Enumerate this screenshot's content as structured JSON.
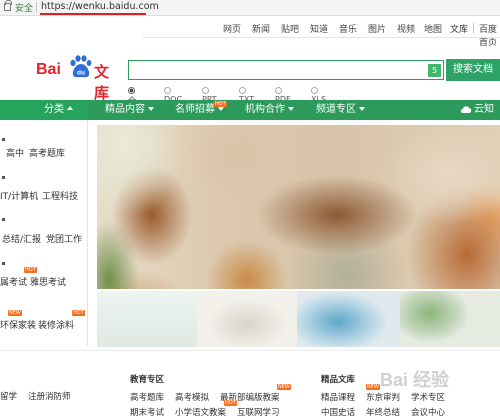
{
  "address_bar": {
    "security_label": "安全",
    "url": "https://wenku.baidu.com"
  },
  "top_nav": {
    "links": [
      "网页",
      "新闻",
      "贴吧",
      "知道",
      "音乐",
      "图片",
      "视频",
      "地图",
      "文库"
    ],
    "right_link": "百度首页"
  },
  "logo": {
    "text_left": "Bai",
    "paw_text": "du",
    "text_right": "文库"
  },
  "search": {
    "placeholder": "",
    "badge": "5",
    "button_label": "搜索文档"
  },
  "filters": [
    {
      "label": "全部",
      "selected": true
    },
    {
      "label": "DOC",
      "selected": false
    },
    {
      "label": "PPT",
      "selected": false
    },
    {
      "label": "TXT",
      "selected": false
    },
    {
      "label": "PDF",
      "selected": false
    },
    {
      "label": "XLS",
      "selected": false
    }
  ],
  "menu": {
    "tabs": [
      {
        "label": "分类",
        "caret": "up",
        "active": true
      },
      {
        "label": "精品内容",
        "caret": "down"
      },
      {
        "label": "名师招募",
        "caret": "down",
        "badge": "HOT"
      },
      {
        "label": "机构合作",
        "caret": "down"
      },
      {
        "label": "频道专区",
        "caret": "down"
      }
    ],
    "right_label": "云知识"
  },
  "sidebar": {
    "rows": [
      {
        "items": [
          "高中",
          "高考题库"
        ]
      },
      {
        "items": [
          "IT/计算机",
          "工程科技"
        ]
      },
      {
        "items": [
          "总结/汇报",
          "党团工作"
        ]
      },
      {
        "items": [
          "属考试",
          "雅思考试"
        ],
        "hot": "HOT"
      },
      {
        "items": [
          "环保家装",
          "装修涂料"
        ],
        "hot_left": "NEW",
        "hot_right": "HOT"
      }
    ]
  },
  "education": {
    "title": "教育专区",
    "rows": [
      [
        "高考题库",
        "高考模拟",
        "最新部编版教案"
      ],
      [
        "期末考试",
        "小学语文教案",
        "互联网学习"
      ]
    ],
    "badges": {
      "r0c2": "NEW",
      "r1c2": "HOT"
    }
  },
  "premium": {
    "title": "精品文库",
    "rows": [
      [
        "精品课程",
        "东京审判",
        "学术专区"
      ],
      [
        "中国史话",
        "年终总结",
        "会议中心"
      ]
    ],
    "badges": {
      "r0c1": "NEW"
    }
  },
  "left_bottom": {
    "row1": [
      "留学",
      "注册消防师"
    ]
  },
  "watermark": "Bai 经验",
  "colors": {
    "brand_green": "#2b9a5b",
    "brand_red": "#e4232b",
    "hot_orange": "#f37020"
  }
}
